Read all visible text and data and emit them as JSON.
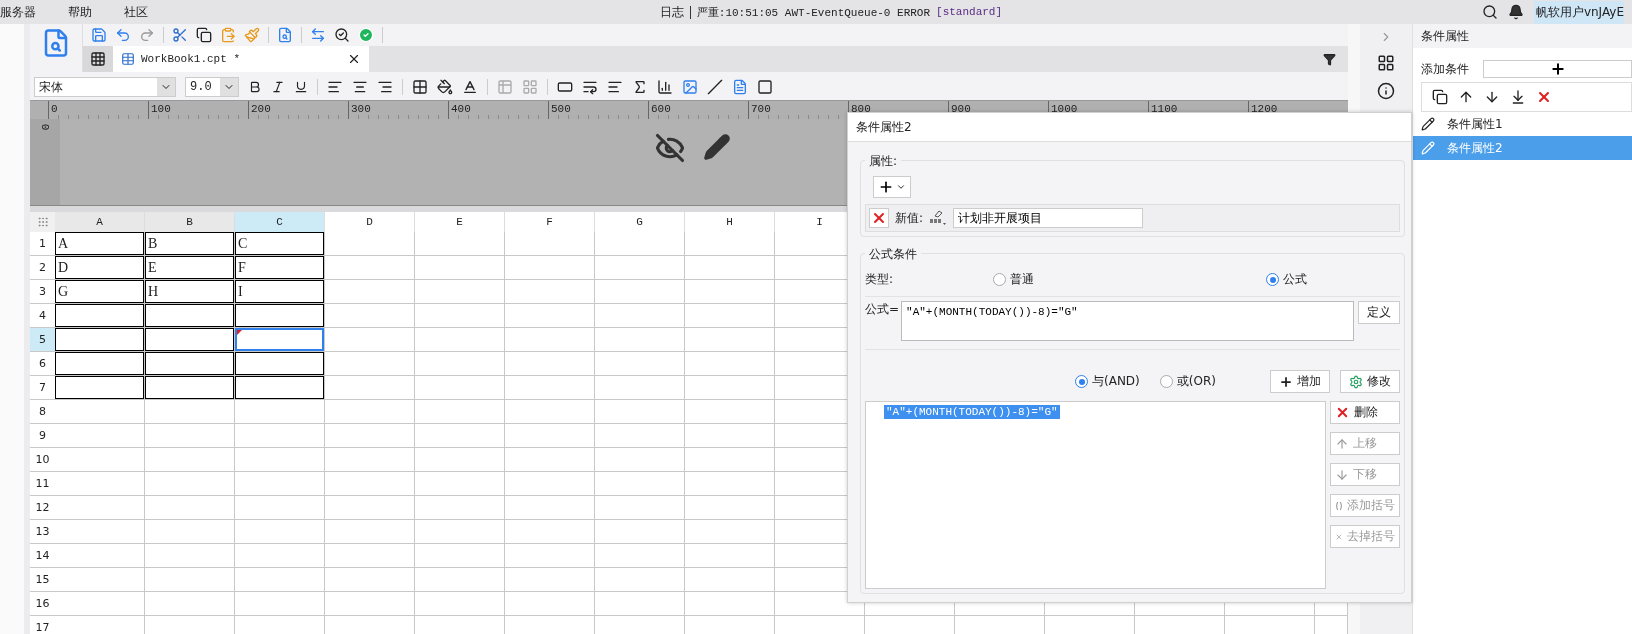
{
  "menu": [
    {
      "label": "服务器"
    },
    {
      "label": "帮助"
    },
    {
      "label": "社区"
    }
  ],
  "log": {
    "label": "日志",
    "message": "严重:10:51:05 AWT-EventQueue-0 ERROR",
    "tag": "[standard]"
  },
  "user": "帆软用户vnJAyE",
  "tab": {
    "title": "WorkBook1.cpt *",
    "selected": true
  },
  "font": {
    "family": "宋体",
    "size": "9.0"
  },
  "ruler": [
    "0",
    "100",
    "200",
    "300",
    "400",
    "500",
    "600",
    "700",
    "800",
    "900",
    "1000",
    "1100",
    "1200"
  ],
  "vertical_ruler": "0",
  "sheet": {
    "columns": [
      {
        "label": "A",
        "selected": false
      },
      {
        "label": "B",
        "selected": false
      },
      {
        "label": "C",
        "selected": true
      },
      {
        "label": "D",
        "selected": false
      },
      {
        "label": "E",
        "selected": false
      },
      {
        "label": "F",
        "selected": false
      },
      {
        "label": "G",
        "selected": false
      },
      {
        "label": "H",
        "selected": false
      },
      {
        "label": "I",
        "selected": false
      }
    ],
    "rows": [
      {
        "label": "1",
        "selected": false,
        "cells": [
          {
            "text": "A",
            "bordered": true,
            "selected": false,
            "flagged": false
          },
          {
            "text": "B",
            "bordered": true,
            "selected": false,
            "flagged": false
          },
          {
            "text": "C",
            "bordered": true,
            "selected": false,
            "flagged": false
          }
        ]
      },
      {
        "label": "2",
        "selected": false,
        "cells": [
          {
            "text": "D",
            "bordered": true,
            "selected": false,
            "flagged": false
          },
          {
            "text": "E",
            "bordered": true,
            "selected": false,
            "flagged": false
          },
          {
            "text": "F",
            "bordered": true,
            "selected": false,
            "flagged": false
          }
        ]
      },
      {
        "label": "3",
        "selected": false,
        "cells": [
          {
            "text": "G",
            "bordered": true,
            "selected": false,
            "flagged": false
          },
          {
            "text": "H",
            "bordered": true,
            "selected": false,
            "flagged": false
          },
          {
            "text": "I",
            "bordered": true,
            "selected": false,
            "flagged": false
          }
        ]
      },
      {
        "label": "4",
        "selected": false,
        "cells": [
          {
            "bordered": true,
            "selected": false,
            "flagged": false
          },
          {
            "bordered": true,
            "selected": false,
            "flagged": false
          },
          {
            "bordered": true,
            "selected": false,
            "flagged": false
          }
        ]
      },
      {
        "label": "5",
        "selected": true,
        "cells": [
          {
            "bordered": true,
            "selected": false,
            "flagged": false
          },
          {
            "bordered": true,
            "selected": false,
            "flagged": false
          },
          {
            "bordered": true,
            "selected": true,
            "flagged": true
          }
        ]
      },
      {
        "label": "6",
        "selected": false,
        "cells": [
          {
            "bordered": true,
            "selected": false,
            "flagged": false
          },
          {
            "bordered": true,
            "selected": false,
            "flagged": false
          },
          {
            "bordered": true,
            "selected": false,
            "flagged": false
          }
        ]
      },
      {
        "label": "7",
        "selected": false,
        "cells": [
          {
            "bordered": true,
            "selected": false,
            "flagged": false
          },
          {
            "bordered": true,
            "selected": false,
            "flagged": false
          },
          {
            "bordered": true,
            "selected": false,
            "flagged": false
          }
        ]
      },
      {
        "label": "8",
        "selected": false
      },
      {
        "label": "9",
        "selected": false
      },
      {
        "label": "10",
        "selected": false
      },
      {
        "label": "11",
        "selected": false
      },
      {
        "label": "12",
        "selected": false
      },
      {
        "label": "13",
        "selected": false
      },
      {
        "label": "14",
        "selected": false
      },
      {
        "label": "15",
        "selected": false
      },
      {
        "label": "16",
        "selected": false
      },
      {
        "label": "17",
        "selected": false
      }
    ]
  },
  "dialog": {
    "title": "条件属性2",
    "attributes": {
      "legend": "属性:",
      "value_label": "新值:",
      "value": "计划非开展项目"
    },
    "formula_condition": {
      "legend": "公式条件",
      "type_label": "类型:",
      "type_options": [
        {
          "label": "普通",
          "selected": false
        },
        {
          "label": "公式",
          "selected": true
        }
      ],
      "formula_label": "公式=",
      "formula": "\"A\"+(MONTH(TODAY())-8)=\"G\"",
      "define_button": "定义",
      "logic_options": [
        {
          "label": "与(AND)",
          "selected": true
        },
        {
          "label": "或(OR)",
          "selected": false
        }
      ],
      "buttons": [
        {
          "label": "增加"
        },
        {
          "label": "修改"
        }
      ],
      "conditions": [
        {
          "text": "\"A\"+(MONTH(TODAY())-8)=\"G\"",
          "selected": true
        }
      ],
      "side_buttons": [
        {
          "label": "删除",
          "disabled": false
        },
        {
          "label": "上移",
          "disabled": true
        },
        {
          "label": "下移",
          "disabled": true
        },
        {
          "label": "添加括号",
          "disabled": true
        },
        {
          "label": "去掉括号",
          "disabled": true
        }
      ]
    }
  },
  "panel": {
    "title": "条件属性",
    "add_label": "添加条件",
    "items": [
      {
        "label": "条件属性1",
        "selected": false
      },
      {
        "label": "条件属性2",
        "selected": true
      }
    ]
  }
}
